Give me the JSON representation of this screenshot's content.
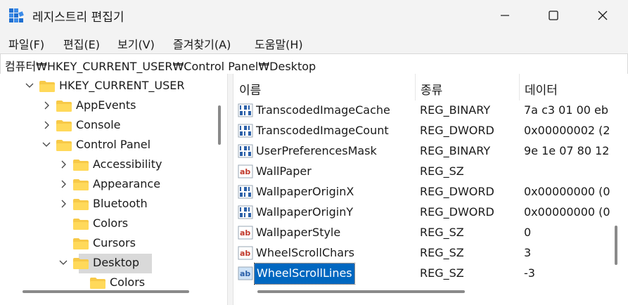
{
  "window": {
    "title": "레지스트리 편집기",
    "controls": [
      "minimize-icon",
      "maximize-icon",
      "close-icon"
    ]
  },
  "menu": [
    "파일(F)",
    "편집(E)",
    "보기(V)",
    "즐겨찾기(A)",
    "도움말(H)"
  ],
  "address": "컴퓨터₩HKEY_CURRENT_USER₩Control Panel₩Desktop",
  "tree": [
    {
      "label": "HKEY_CURRENT_USER",
      "chevron": "down",
      "depth": 1
    },
    {
      "label": "AppEvents",
      "chevron": "right",
      "depth": 2
    },
    {
      "label": "Console",
      "chevron": "right",
      "depth": 2
    },
    {
      "label": "Control Panel",
      "chevron": "down",
      "depth": 2
    },
    {
      "label": "Accessibility",
      "chevron": "right",
      "depth": 3
    },
    {
      "label": "Appearance",
      "chevron": "right",
      "depth": 3
    },
    {
      "label": "Bluetooth",
      "chevron": "right",
      "depth": 3
    },
    {
      "label": "Colors",
      "chevron": "none",
      "depth": 3
    },
    {
      "label": "Cursors",
      "chevron": "none",
      "depth": 3
    },
    {
      "label": "Desktop",
      "chevron": "down",
      "depth": 3,
      "selected": true
    },
    {
      "label": "Colors",
      "chevron": "none",
      "depth": 4
    }
  ],
  "columns": {
    "name": "이름",
    "type": "종류",
    "data": "데이터"
  },
  "values": [
    {
      "name": "TranscodedImageCache",
      "type": "REG_BINARY",
      "data": "7a c3 01 00 eb",
      "icon": "binary-value-icon"
    },
    {
      "name": "TranscodedImageCount",
      "type": "REG_DWORD",
      "data": "0x00000002 (2",
      "icon": "binary-value-icon"
    },
    {
      "name": "UserPreferencesMask",
      "type": "REG_BINARY",
      "data": "9e 1e 07 80 12",
      "icon": "binary-value-icon"
    },
    {
      "name": "WallPaper",
      "type": "REG_SZ",
      "data": "",
      "icon": "string-value-icon"
    },
    {
      "name": "WallpaperOriginX",
      "type": "REG_DWORD",
      "data": "0x00000000 (0",
      "icon": "binary-value-icon"
    },
    {
      "name": "WallpaperOriginY",
      "type": "REG_DWORD",
      "data": "0x00000000 (0",
      "icon": "binary-value-icon"
    },
    {
      "name": "WallpaperStyle",
      "type": "REG_SZ",
      "data": "0",
      "icon": "string-value-icon"
    },
    {
      "name": "WheelScrollChars",
      "type": "REG_SZ",
      "data": "3",
      "icon": "string-value-icon"
    },
    {
      "name": "WheelScrollLines",
      "type": "REG_SZ",
      "data": "-3",
      "icon": "string-value-icon",
      "selected": true
    }
  ],
  "colors": {
    "selection": "#0067c0",
    "folder": "#f7c948",
    "tree_selection": "#d9d9d9"
  }
}
